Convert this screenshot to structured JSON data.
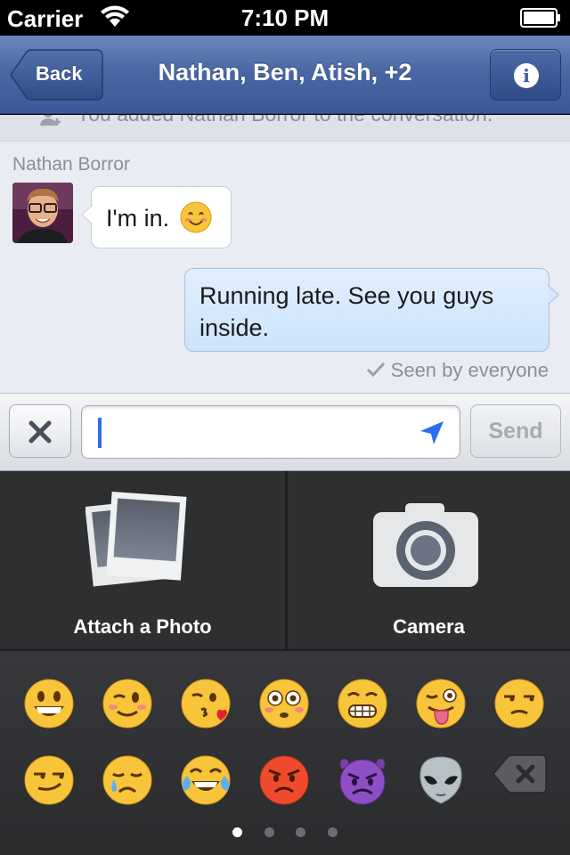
{
  "status_bar": {
    "carrier": "Carrier",
    "time": "7:10 PM"
  },
  "nav": {
    "back_label": "Back",
    "title": "Nathan, Ben, Atish, +2",
    "info_icon": "info-icon"
  },
  "conversation": {
    "system_message": "You added Nathan Borror to the conversation.",
    "incoming": {
      "sender": "Nathan Borror",
      "text": "I'm in.",
      "emoji": "smiling-face-emoji"
    },
    "outgoing": {
      "text": "Running late. See you guys inside."
    },
    "seen_status": "Seen by everyone"
  },
  "composer": {
    "input_value": "",
    "send_label": "Send"
  },
  "media": {
    "attach_label": "Attach a Photo",
    "camera_label": "Camera"
  },
  "emoji_keyboard": {
    "row1": [
      "grinning-face",
      "winking-face",
      "face-blowing-kiss",
      "flushed-face",
      "grimacing-face",
      "winking-face-with-tongue",
      "unamused-face"
    ],
    "row2": [
      "smirking-face",
      "crying-face",
      "face-with-tears-of-joy",
      "pouting-face",
      "imp",
      "alien",
      "delete-key"
    ],
    "pages": 4,
    "active_page": 1
  },
  "colors": {
    "nav_blue": "#3b5998",
    "conversation_bg": "#e9ecf3",
    "outgoing_bubble": "#d6e8fd",
    "keyboard_bg": "#2e2f31",
    "cursor_blue": "#2f6df0"
  }
}
